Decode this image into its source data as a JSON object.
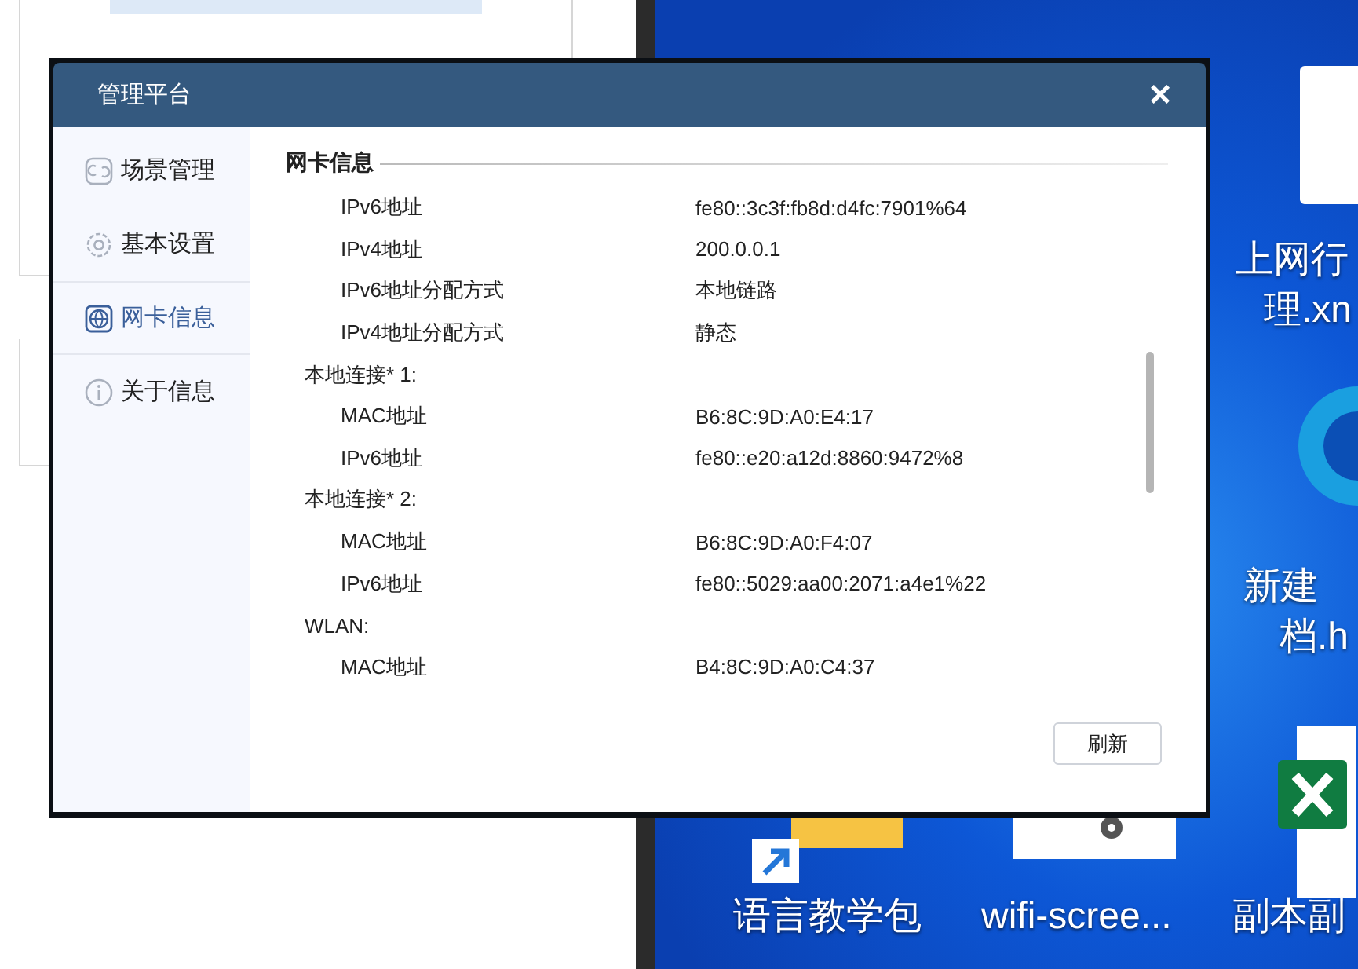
{
  "desktop": {
    "icons": [
      {
        "kind": "file",
        "label": [
          "上网行",
          "理.xn"
        ]
      },
      {
        "kind": "browser"
      },
      {
        "kind": "document",
        "label": [
          "新建",
          "档.h"
        ]
      },
      {
        "kind": "spreadsheet"
      },
      {
        "kind": "folder",
        "label": [
          "语言教学包"
        ]
      },
      {
        "kind": "settings",
        "label": [
          "wifi-scree..."
        ]
      },
      {
        "kind": "text",
        "label": [
          "副本副"
        ]
      }
    ]
  },
  "dialog": {
    "title": "管理平台",
    "close": "×",
    "sidebar": {
      "items": [
        {
          "label": "场景管理",
          "selected": false
        },
        {
          "label": "基本设置",
          "selected": false
        },
        {
          "label": "网卡信息",
          "selected": true
        },
        {
          "label": "关于信息",
          "selected": false
        }
      ]
    },
    "section_title": "网卡信息",
    "rows": [
      {
        "kind": "field",
        "label": "IPv6地址",
        "value": "fe80::3c3f:fb8d:d4fc:7901%64"
      },
      {
        "kind": "field",
        "label": "IPv4地址",
        "value": "200.0.0.1"
      },
      {
        "kind": "field",
        "label": "IPv6地址分配方式",
        "value": "本地链路"
      },
      {
        "kind": "field",
        "label": "IPv4地址分配方式",
        "value": "静态"
      },
      {
        "kind": "group",
        "label": "本地连接* 1:"
      },
      {
        "kind": "field",
        "label": "MAC地址",
        "value": "B6:8C:9D:A0:E4:17"
      },
      {
        "kind": "field",
        "label": "IPv6地址",
        "value": "fe80::e20:a12d:8860:9472%8"
      },
      {
        "kind": "group",
        "label": "本地连接* 2:"
      },
      {
        "kind": "field",
        "label": "MAC地址",
        "value": "B6:8C:9D:A0:F4:07"
      },
      {
        "kind": "field",
        "label": "IPv6地址",
        "value": "fe80::5029:aa00:2071:a4e1%22"
      },
      {
        "kind": "group",
        "label": "WLAN:"
      },
      {
        "kind": "field",
        "label": "MAC地址",
        "value": "B4:8C:9D:A0:C4:37"
      }
    ],
    "refresh_button": "刷新"
  }
}
